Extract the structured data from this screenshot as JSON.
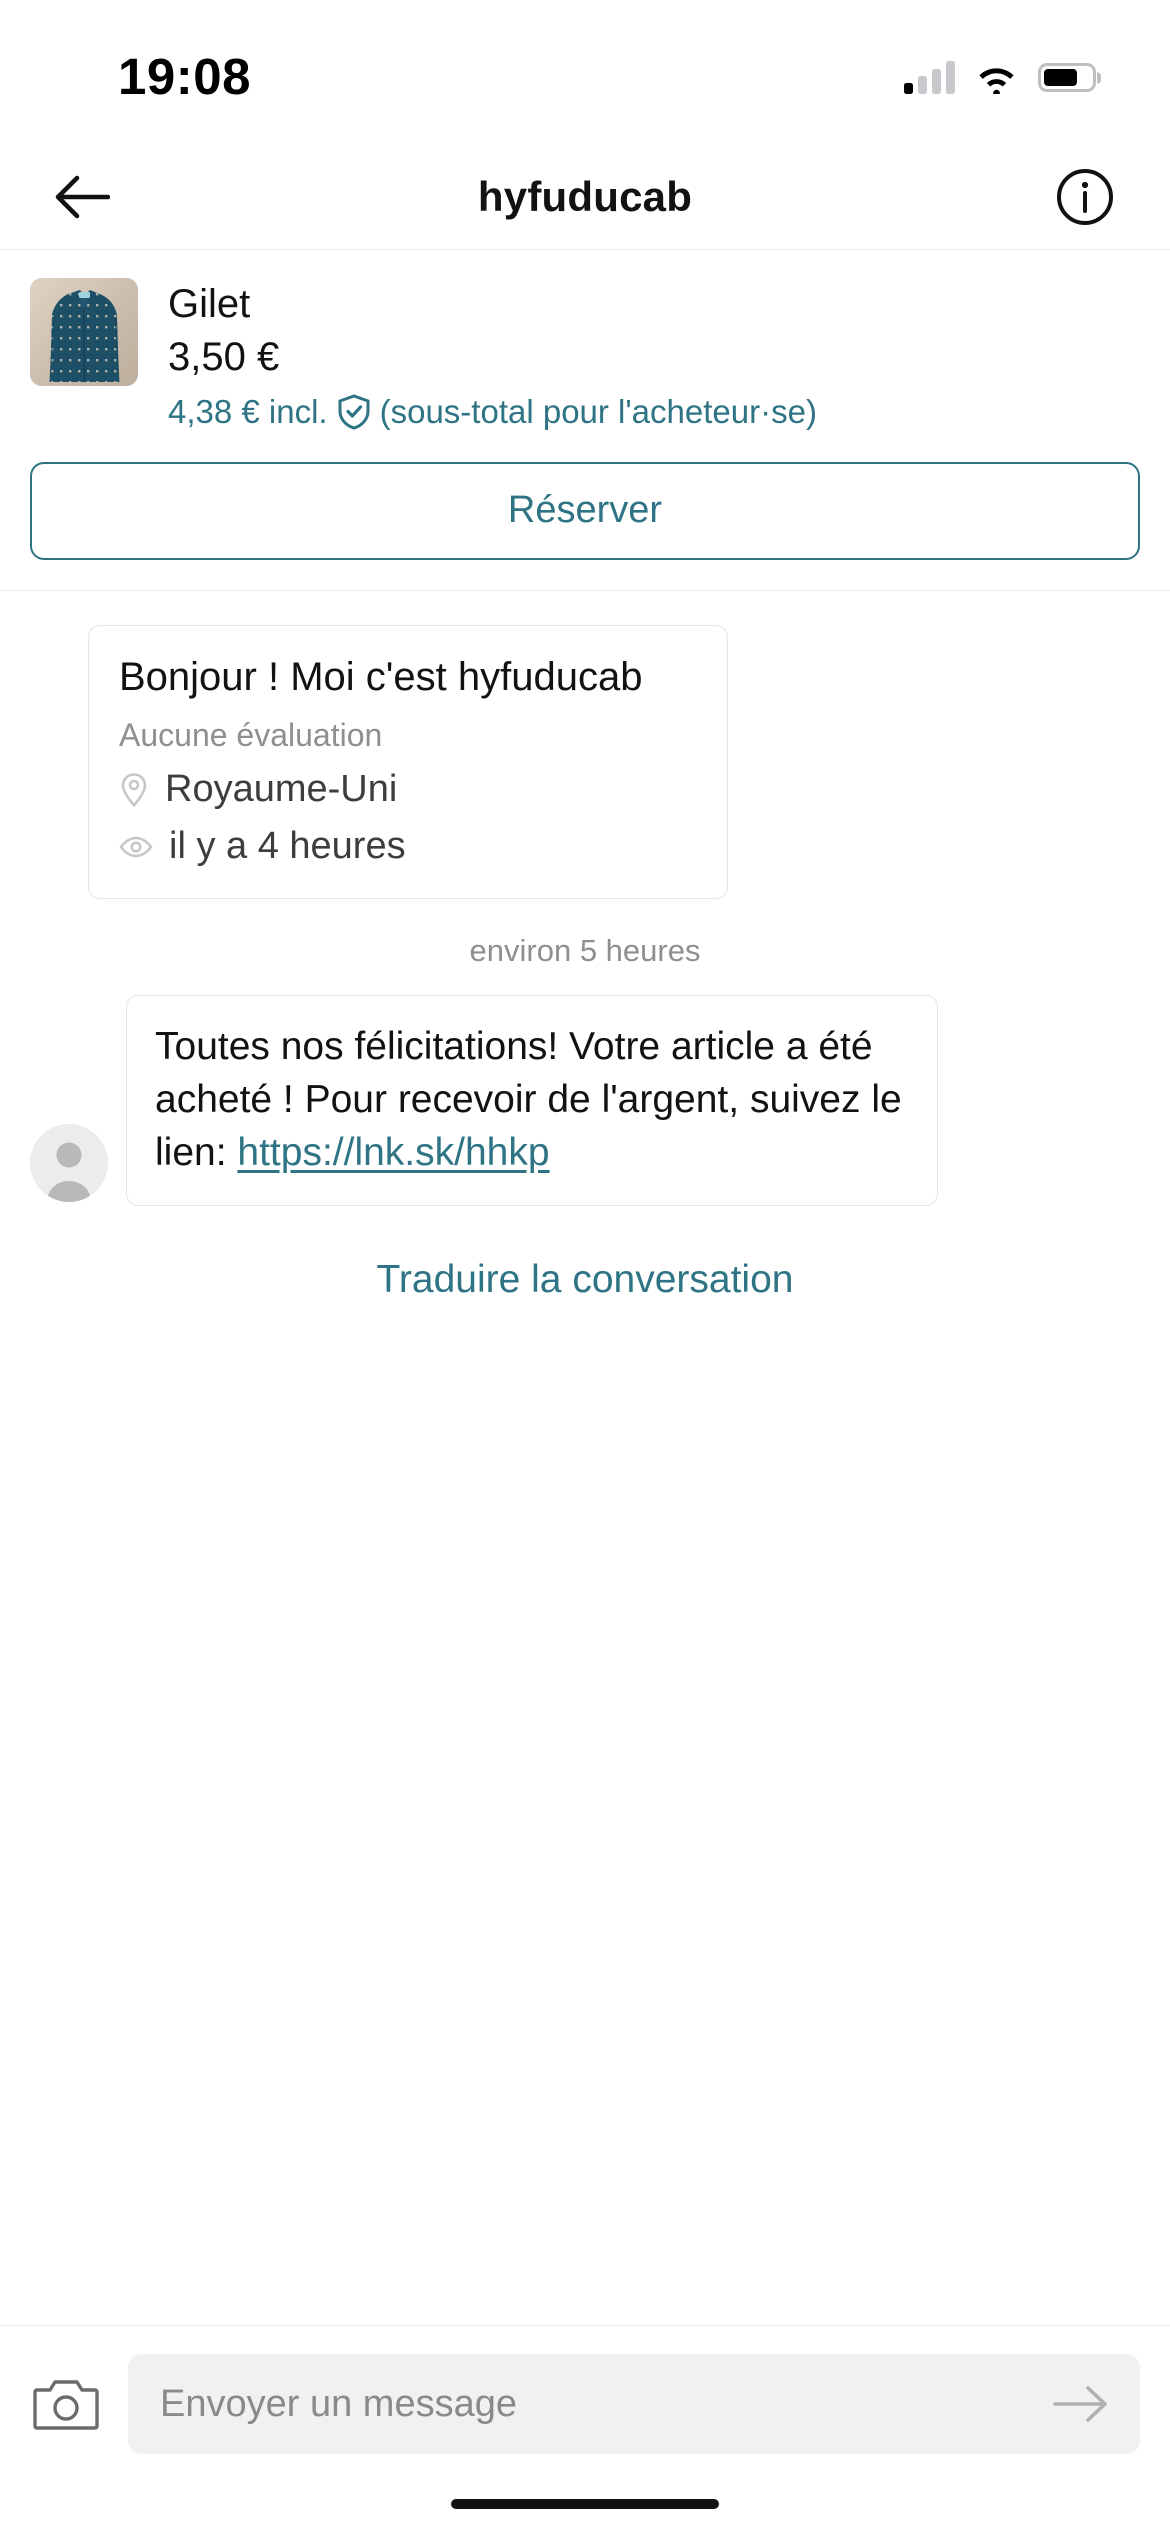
{
  "status_bar": {
    "time": "19:08",
    "signal_icon": "cellular-signal-icon",
    "wifi_icon": "wifi-icon",
    "battery_icon": "battery-icon"
  },
  "header": {
    "back_icon": "back-arrow-icon",
    "title": "hyfuducab",
    "info_icon": "info-circle-icon"
  },
  "item": {
    "thumbnail_alt": "gilet-thumbnail",
    "title": "Gilet",
    "price": "3,50 €",
    "incl_price": "4,38 € incl.",
    "incl_note": "(sous-total pour l'acheteur·se)",
    "shield_icon": "shield-check-icon",
    "reserve_label": "Réserver"
  },
  "conversation": {
    "profile_card": {
      "greeting": "Bonjour ! Moi c'est hyfuducab",
      "rating": "Aucune évaluation",
      "location_icon": "location-pin-icon",
      "location": "Royaume-Uni",
      "seen_icon": "eye-icon",
      "last_seen": "il y a 4 heures"
    },
    "time_divider": "environ 5 heures",
    "message": {
      "avatar_icon": "default-avatar-icon",
      "text_before_link": "Toutes nos félicitations! Votre article a été acheté ! Pour recevoir de l'argent, suivez le lien: ",
      "link_text": "https://lnk.sk/hhkp"
    },
    "translate_label": "Traduire la conversation"
  },
  "composer": {
    "camera_icon": "camera-icon",
    "placeholder": "Envoyer un message",
    "value": "",
    "send_icon": "send-arrow-icon"
  },
  "colors": {
    "accent_teal": "#2e7484",
    "text_primary": "#121212",
    "text_muted": "#8f8f8f",
    "border": "#e6e6e6",
    "input_bg": "#f1f1f1"
  }
}
